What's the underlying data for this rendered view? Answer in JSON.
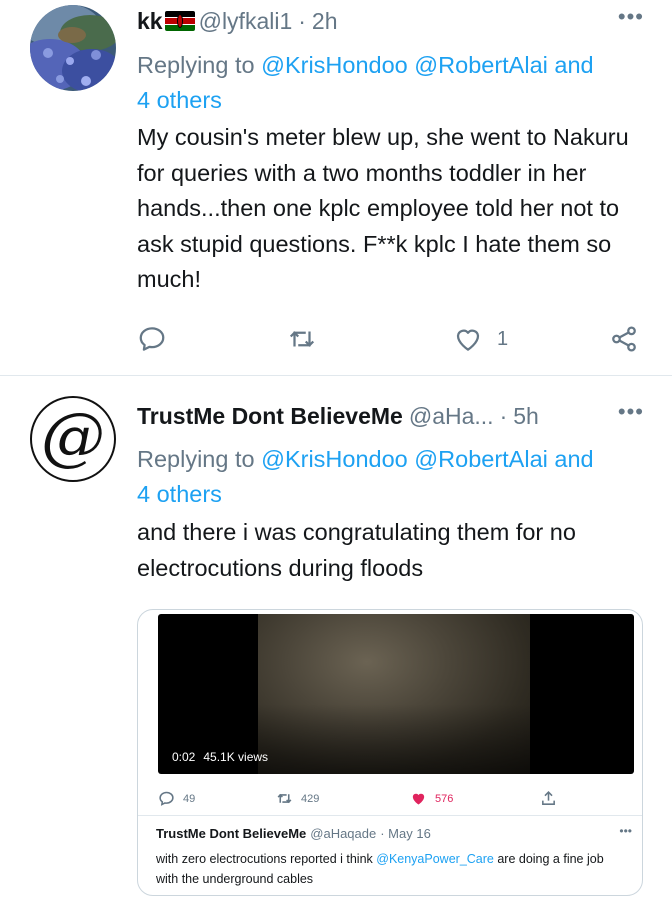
{
  "tweets": [
    {
      "name": "kk",
      "flag": "kenya-flag",
      "handle": "@lyfkali1",
      "separator": "·",
      "time": "2h",
      "more": "•••",
      "replying_prefix": "Replying to ",
      "mention1": "@KrisHondoo",
      "mention2": "@RobertAlai",
      "and_text": " and ",
      "others": "4 others",
      "body": "My cousin's meter blew up, she went to Nakuru for queries with a two months toddler in her hands...then one kplc employee told her not to ask stupid questions. F**k kplc I hate them so much!",
      "actions": {
        "reply_icon": "comment-icon",
        "retweet_icon": "retweet-icon",
        "like_icon": "heart-icon",
        "like_count": "1",
        "share_icon": "share-icon"
      }
    },
    {
      "name": "TrustMe Dont BelieveMe",
      "avatar_glyph": "@",
      "handle": "@aHa...",
      "separator": "·",
      "time": "5h",
      "more": "•••",
      "replying_prefix": "Replying to ",
      "mention1": "@KrisHondoo",
      "mention2": "@RobertAlai",
      "and_text": " and ",
      "others": "4 others",
      "body": "and there i was congratulating them for no electrocutions during floods",
      "media": {
        "video_time": "0:02",
        "video_views": "45.1K views",
        "reply_count": "49",
        "retweet_count": "429",
        "like_count": "576",
        "like_color": "#e0245e",
        "quoted": {
          "name": "TrustMe Dont BelieveMe",
          "handle": "@aHaqade",
          "date": "· May 16",
          "more": "•••",
          "body_before": "with zero electrocutions reported i think ",
          "mention": "@KenyaPower_Care",
          "body_after": " are doing a fine job with the underground cables"
        }
      }
    }
  ],
  "colors": {
    "accent": "#1da1f2",
    "secondary_text": "#657786",
    "divider": "#e1e8ed"
  }
}
